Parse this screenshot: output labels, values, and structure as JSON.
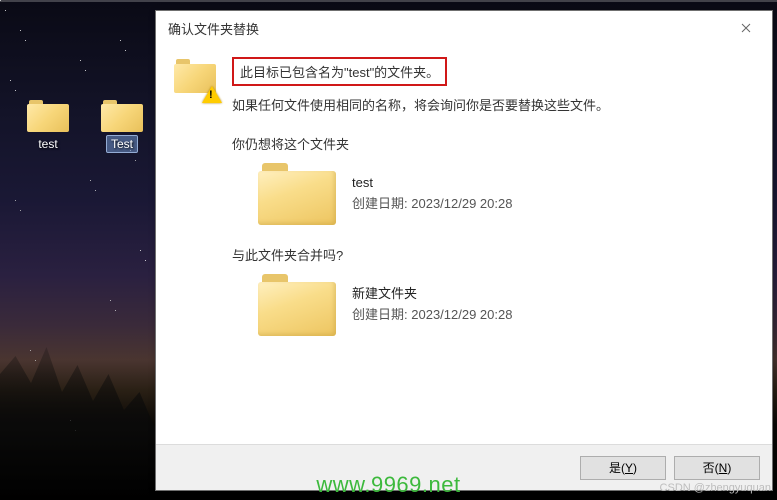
{
  "desktop": {
    "icons": [
      {
        "label": "test",
        "selected": false
      },
      {
        "label": "Test",
        "selected": true
      }
    ]
  },
  "dialog": {
    "title": "确认文件夹替换",
    "headline": "此目标已包含名为\"test\"的文件夹。",
    "subline": "如果任何文件使用相同的名称，将会询问你是否要替换这些文件。",
    "section1": "你仍想将这个文件夹",
    "folder1": {
      "name": "test",
      "date_label": "创建日期:",
      "date": "2023/12/29 20:28"
    },
    "section2": "与此文件夹合并吗?",
    "folder2": {
      "name": "新建文件夹",
      "date_label": "创建日期:",
      "date": "2023/12/29 20:28"
    },
    "buttons": {
      "yes": "是(Y)",
      "no": "否(N)"
    }
  },
  "watermark": {
    "site": "www.9969.net",
    "credit": "CSDN @zhengyuquan"
  }
}
